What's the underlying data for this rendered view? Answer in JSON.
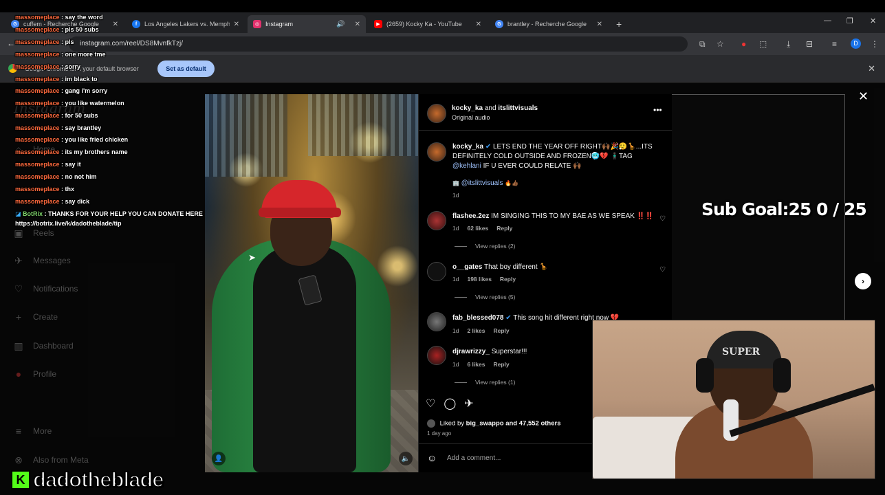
{
  "browser": {
    "tabs": [
      {
        "title": "cuffem - Recherche Google",
        "icon": "google-icon",
        "color": "#4285f4"
      },
      {
        "title": "Los Angeles Lakers vs. Memphi",
        "icon": "facebook-icon",
        "color": "#1877f2"
      },
      {
        "title": "Instagram",
        "icon": "instagram-icon",
        "color": "#e1306c"
      },
      {
        "title": "(2659) Kocky Ka - YouTube",
        "icon": "youtube-icon",
        "color": "#ff0000"
      },
      {
        "title": "brantley - Recherche Google",
        "icon": "google-icon",
        "color": "#4285f4"
      }
    ],
    "url": "instagram.com/reel/DS8MvnfkTzj/",
    "infobar_message": "Google Chrome isn't your default browser",
    "infobar_button": "Set as default"
  },
  "instagram": {
    "logo": "Instagram",
    "sidebar": [
      {
        "label": "Home",
        "icon": "home-icon"
      },
      {
        "label": "Reels",
        "icon": "reels-icon"
      },
      {
        "label": "Messages",
        "icon": "messages-icon"
      },
      {
        "label": "Notifications",
        "icon": "heart-icon"
      },
      {
        "label": "Create",
        "icon": "plus-icon"
      },
      {
        "label": "Dashboard",
        "icon": "dashboard-icon"
      },
      {
        "label": "Profile",
        "icon": "profile-icon"
      },
      {
        "label": "More",
        "icon": "menu-icon"
      },
      {
        "label": "Also from Meta",
        "icon": "meta-icon"
      }
    ],
    "post": {
      "header_user": "kocky_ka",
      "header_and": "and",
      "header_collab": "itslittvisuals",
      "audio": "Original audio",
      "caption_user": "kocky_ka",
      "caption": "LETS END THE YEAR OFF RIGHT🙌🏾🎉😮‍💨🦒...ITS DEFINITELY COLD OUTSIDE AND FROZEN🥶💔 🧍🏿‍♂️TAG",
      "caption_tag": "@kehlani",
      "caption_end": "IF U EVER COULD RELATE 🙌🏾",
      "mention": "@itslittvisuals",
      "caption_time": "1d",
      "liked_by_prefix": "Liked by",
      "liked_by_user": "big_swappo",
      "liked_by_suffix": "and 47,552 others",
      "posted": "1 day ago",
      "add_comment": "Add a comment..."
    },
    "comments": [
      {
        "user": "flashee.2ez",
        "text": "IM SINGING THIS TO MY BAE AS WE SPEAK ‼️‼️",
        "time": "1d",
        "likes": "62 likes",
        "reply": "Reply",
        "replies": "View replies (2)"
      },
      {
        "user": "o__gates",
        "text": "That boy different 🦒",
        "time": "1d",
        "likes": "198 likes",
        "reply": "Reply",
        "replies": "View replies (5)"
      },
      {
        "user": "fab_blessed078",
        "text": "This song hit different right now 💔",
        "time": "1d",
        "likes": "2 likes",
        "reply": "Reply",
        "replies": ""
      },
      {
        "user": "djrawrizzy_",
        "text": "Superstar!!!",
        "time": "1d",
        "likes": "6 likes",
        "reply": "Reply",
        "replies": "View replies (1)"
      }
    ]
  },
  "stream": {
    "sub_goal": "Sub Goal:25  0 / 25",
    "streamer_name": "dadotheblade",
    "webcam_beanie": "SUPER",
    "chat": [
      {
        "user": "massomeplace",
        "text": "say the word"
      },
      {
        "user": "massomeplace",
        "text": "pls 50 subs"
      },
      {
        "user": "massomeplace",
        "text": "pls"
      },
      {
        "user": "massomeplace",
        "text": "one more tme"
      },
      {
        "user": "massomeplace",
        "text": "sorry"
      },
      {
        "user": "massomeplace",
        "text": "im black to"
      },
      {
        "user": "massomeplace",
        "text": "gang i'm sorry"
      },
      {
        "user": "massomeplace",
        "text": "you like watermelon"
      },
      {
        "user": "massomeplace",
        "text": "for 50 subs"
      },
      {
        "user": "massomeplace",
        "text": "say brantley"
      },
      {
        "user": "massomeplace",
        "text": "you like fried chicken"
      },
      {
        "user": "massomeplace",
        "text": "its my brothers name"
      },
      {
        "user": "massomeplace",
        "text": "say it"
      },
      {
        "user": "massomeplace",
        "text": "no not him"
      },
      {
        "user": "massomeplace",
        "text": "thx"
      },
      {
        "user": "massomeplace",
        "text": "say dick"
      }
    ],
    "bot": {
      "user": "BotRix",
      "text": "THANKS FOR YOUR HELP YOU CAN DONATE HERE",
      "link": "https://botrix.live/k/dadotheblade/tip"
    }
  }
}
